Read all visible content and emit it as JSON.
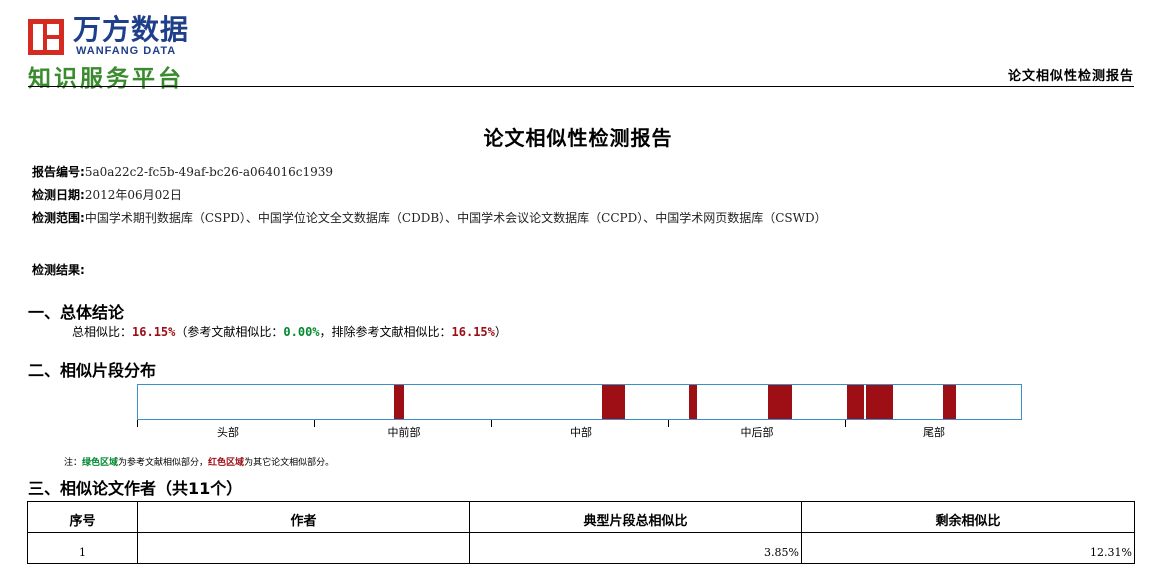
{
  "header": {
    "logo_cn": "万方数据",
    "logo_en": "WANFANG DATA",
    "platform": "知识服务平台",
    "right_title": "论文相似性检测报告"
  },
  "document": {
    "title": "论文相似性检测报告",
    "report_no_label": "报告编号:",
    "report_no": "5a0a22c2-fc5b-49af-bc26-a064016c1939",
    "date_label": "检测日期:",
    "date": "2012年06月02日",
    "scope_label": "检测范围:",
    "scope": "中国学术期刊数据库（CSPD）、中国学位论文全文数据库（CDDB）、中国学术会议论文数据库（CCPD）、中国学术网页数据库（CSWD）",
    "result_label": "检测结果:"
  },
  "section1": {
    "title": "一、总体结论",
    "total_label": "总相似比：",
    "total_value": "16.15%",
    "ref_open": "（参考文献相似比：",
    "ref_value": "0.00%",
    "excl_label": "，排除参考文献相似比：",
    "excl_value": "16.15%",
    "close": "）"
  },
  "section2": {
    "title": "二、相似片段分布",
    "axis_labels": [
      "头部",
      "中前部",
      "中部",
      "中后部",
      "尾部"
    ],
    "segments": [
      {
        "start": 0.29,
        "end": 0.301
      },
      {
        "start": 0.525,
        "end": 0.552
      },
      {
        "start": 0.624,
        "end": 0.633
      },
      {
        "start": 0.714,
        "end": 0.741
      },
      {
        "start": 0.803,
        "end": 0.822
      },
      {
        "start": 0.824,
        "end": 0.855
      },
      {
        "start": 0.912,
        "end": 0.926
      }
    ],
    "segment_color": "#9e0e15",
    "border_color": "#3d8fc7",
    "note_prefix": "注：",
    "note_green": "绿色区域",
    "note_mid": "为参考文献相似部分，",
    "note_red": "红色区域",
    "note_suffix": "为其它论文相似部分。"
  },
  "section3": {
    "title": "三、相似论文作者（共11个）",
    "columns": [
      "序号",
      "作者",
      "典型片段总相似比",
      "剩余相似比"
    ],
    "rows": [
      {
        "no": "1",
        "author": "",
        "typical": "3.85%",
        "remaining": "12.31%"
      }
    ]
  }
}
